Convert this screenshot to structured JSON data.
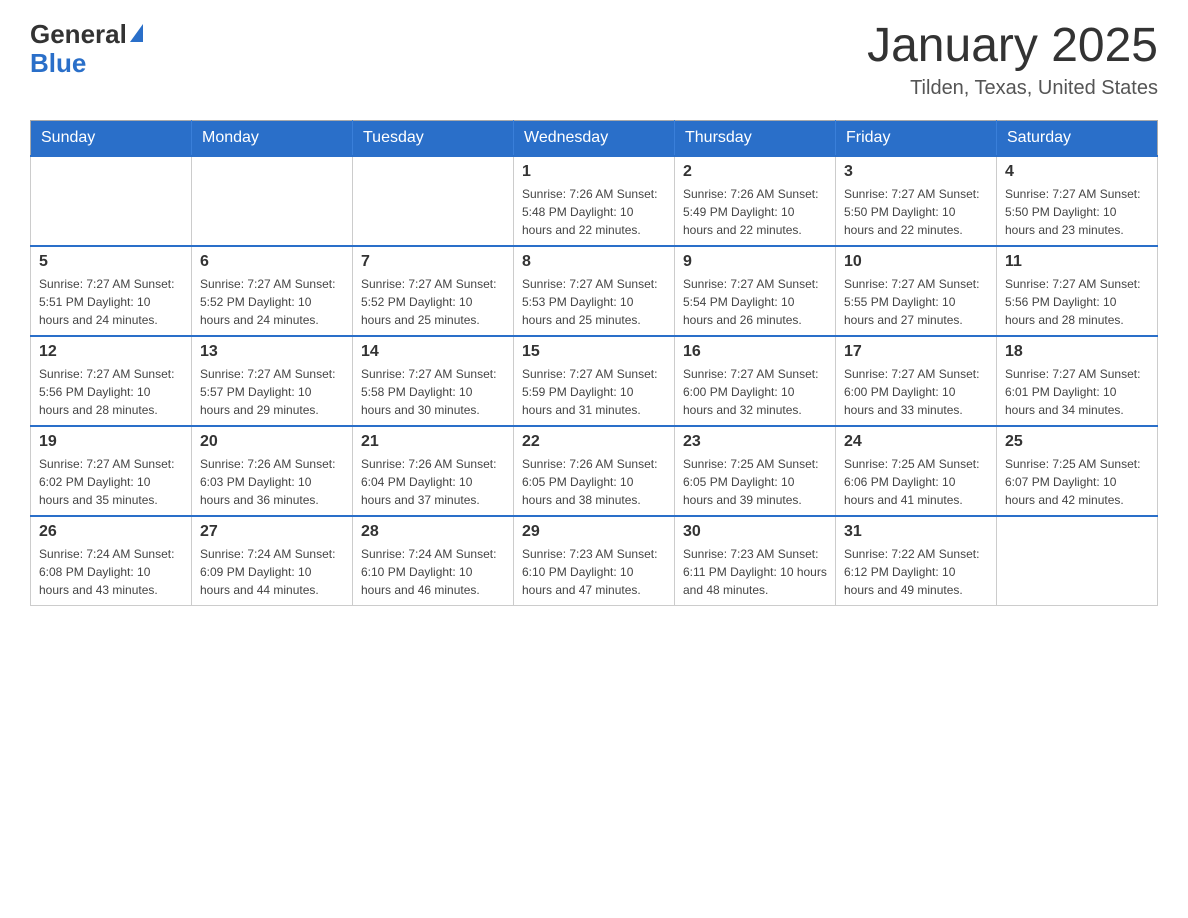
{
  "logo": {
    "general": "General",
    "blue": "Blue"
  },
  "header": {
    "title": "January 2025",
    "location": "Tilden, Texas, United States"
  },
  "days_of_week": [
    "Sunday",
    "Monday",
    "Tuesday",
    "Wednesday",
    "Thursday",
    "Friday",
    "Saturday"
  ],
  "weeks": [
    [
      {
        "day": "",
        "info": ""
      },
      {
        "day": "",
        "info": ""
      },
      {
        "day": "",
        "info": ""
      },
      {
        "day": "1",
        "info": "Sunrise: 7:26 AM\nSunset: 5:48 PM\nDaylight: 10 hours\nand 22 minutes."
      },
      {
        "day": "2",
        "info": "Sunrise: 7:26 AM\nSunset: 5:49 PM\nDaylight: 10 hours\nand 22 minutes."
      },
      {
        "day": "3",
        "info": "Sunrise: 7:27 AM\nSunset: 5:50 PM\nDaylight: 10 hours\nand 22 minutes."
      },
      {
        "day": "4",
        "info": "Sunrise: 7:27 AM\nSunset: 5:50 PM\nDaylight: 10 hours\nand 23 minutes."
      }
    ],
    [
      {
        "day": "5",
        "info": "Sunrise: 7:27 AM\nSunset: 5:51 PM\nDaylight: 10 hours\nand 24 minutes."
      },
      {
        "day": "6",
        "info": "Sunrise: 7:27 AM\nSunset: 5:52 PM\nDaylight: 10 hours\nand 24 minutes."
      },
      {
        "day": "7",
        "info": "Sunrise: 7:27 AM\nSunset: 5:52 PM\nDaylight: 10 hours\nand 25 minutes."
      },
      {
        "day": "8",
        "info": "Sunrise: 7:27 AM\nSunset: 5:53 PM\nDaylight: 10 hours\nand 25 minutes."
      },
      {
        "day": "9",
        "info": "Sunrise: 7:27 AM\nSunset: 5:54 PM\nDaylight: 10 hours\nand 26 minutes."
      },
      {
        "day": "10",
        "info": "Sunrise: 7:27 AM\nSunset: 5:55 PM\nDaylight: 10 hours\nand 27 minutes."
      },
      {
        "day": "11",
        "info": "Sunrise: 7:27 AM\nSunset: 5:56 PM\nDaylight: 10 hours\nand 28 minutes."
      }
    ],
    [
      {
        "day": "12",
        "info": "Sunrise: 7:27 AM\nSunset: 5:56 PM\nDaylight: 10 hours\nand 28 minutes."
      },
      {
        "day": "13",
        "info": "Sunrise: 7:27 AM\nSunset: 5:57 PM\nDaylight: 10 hours\nand 29 minutes."
      },
      {
        "day": "14",
        "info": "Sunrise: 7:27 AM\nSunset: 5:58 PM\nDaylight: 10 hours\nand 30 minutes."
      },
      {
        "day": "15",
        "info": "Sunrise: 7:27 AM\nSunset: 5:59 PM\nDaylight: 10 hours\nand 31 minutes."
      },
      {
        "day": "16",
        "info": "Sunrise: 7:27 AM\nSunset: 6:00 PM\nDaylight: 10 hours\nand 32 minutes."
      },
      {
        "day": "17",
        "info": "Sunrise: 7:27 AM\nSunset: 6:00 PM\nDaylight: 10 hours\nand 33 minutes."
      },
      {
        "day": "18",
        "info": "Sunrise: 7:27 AM\nSunset: 6:01 PM\nDaylight: 10 hours\nand 34 minutes."
      }
    ],
    [
      {
        "day": "19",
        "info": "Sunrise: 7:27 AM\nSunset: 6:02 PM\nDaylight: 10 hours\nand 35 minutes."
      },
      {
        "day": "20",
        "info": "Sunrise: 7:26 AM\nSunset: 6:03 PM\nDaylight: 10 hours\nand 36 minutes."
      },
      {
        "day": "21",
        "info": "Sunrise: 7:26 AM\nSunset: 6:04 PM\nDaylight: 10 hours\nand 37 minutes."
      },
      {
        "day": "22",
        "info": "Sunrise: 7:26 AM\nSunset: 6:05 PM\nDaylight: 10 hours\nand 38 minutes."
      },
      {
        "day": "23",
        "info": "Sunrise: 7:25 AM\nSunset: 6:05 PM\nDaylight: 10 hours\nand 39 minutes."
      },
      {
        "day": "24",
        "info": "Sunrise: 7:25 AM\nSunset: 6:06 PM\nDaylight: 10 hours\nand 41 minutes."
      },
      {
        "day": "25",
        "info": "Sunrise: 7:25 AM\nSunset: 6:07 PM\nDaylight: 10 hours\nand 42 minutes."
      }
    ],
    [
      {
        "day": "26",
        "info": "Sunrise: 7:24 AM\nSunset: 6:08 PM\nDaylight: 10 hours\nand 43 minutes."
      },
      {
        "day": "27",
        "info": "Sunrise: 7:24 AM\nSunset: 6:09 PM\nDaylight: 10 hours\nand 44 minutes."
      },
      {
        "day": "28",
        "info": "Sunrise: 7:24 AM\nSunset: 6:10 PM\nDaylight: 10 hours\nand 46 minutes."
      },
      {
        "day": "29",
        "info": "Sunrise: 7:23 AM\nSunset: 6:10 PM\nDaylight: 10 hours\nand 47 minutes."
      },
      {
        "day": "30",
        "info": "Sunrise: 7:23 AM\nSunset: 6:11 PM\nDaylight: 10 hours\nand 48 minutes."
      },
      {
        "day": "31",
        "info": "Sunrise: 7:22 AM\nSunset: 6:12 PM\nDaylight: 10 hours\nand 49 minutes."
      },
      {
        "day": "",
        "info": ""
      }
    ]
  ]
}
